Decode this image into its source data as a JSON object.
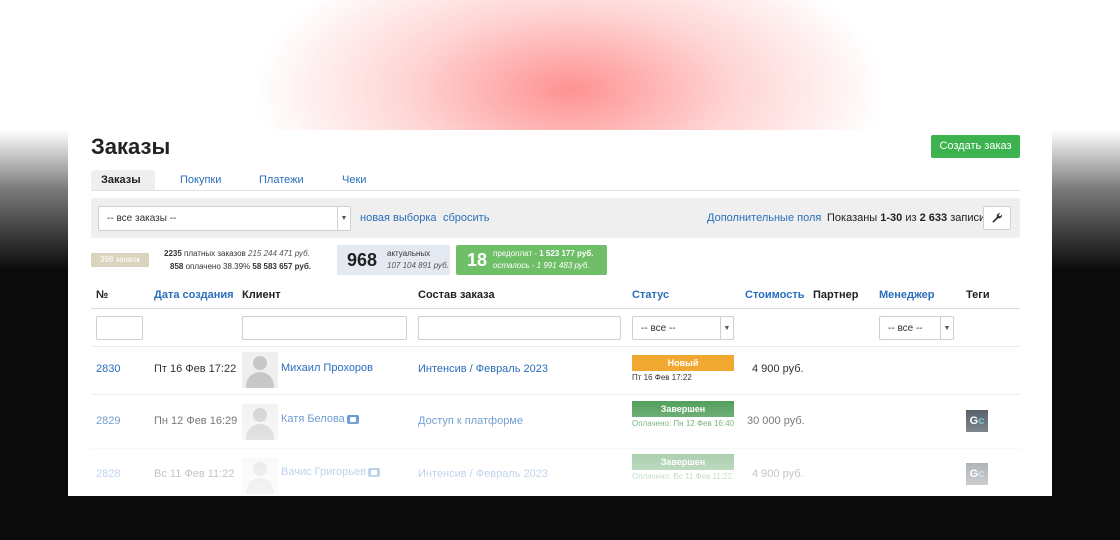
{
  "page": {
    "title": "Заказы",
    "create_button": "Создать заказ"
  },
  "tabs": [
    {
      "label": "Заказы",
      "active": true
    },
    {
      "label": "Покупки",
      "active": false
    },
    {
      "label": "Платежи",
      "active": false
    },
    {
      "label": "Чеки",
      "active": false
    }
  ],
  "filter": {
    "select_value": "-- все заказы --",
    "new_selection": "новая выборка",
    "reset": "сбросить",
    "extra_fields": "Дополнительные поля",
    "shown_prefix": "Показаны ",
    "shown_range": "1-30",
    "shown_mid": " из ",
    "shown_total": "2 633",
    "shown_suffix": " записи."
  },
  "stats": {
    "gray_badge": "398 заявок",
    "paid_count": "2235",
    "paid_label": " платных заказов ",
    "paid_sum": "215 244 471 руб.",
    "paid_done": "858",
    "paid_done_label": " оплачено 38.39% ",
    "paid_done_sum": "58 583 657 руб.",
    "actual_count": "968",
    "actual_label": "актуальных",
    "actual_sum": "107 104 891 руб.",
    "prepay_count": "18",
    "prepay_label": "предоплат - ",
    "prepay_sum": "1 523 177 руб.",
    "remain_label": "осталось - ",
    "remain_sum": "1 991 483 руб."
  },
  "columns": {
    "num": "№",
    "created": "Дата создания",
    "client": "Клиент",
    "content": "Состав заказа",
    "status": "Статус",
    "cost": "Стоимость",
    "partner": "Партнер",
    "manager": "Менеджер",
    "tags": "Теги"
  },
  "column_filters": {
    "status_all": "-- все --",
    "manager_all": "-- все --"
  },
  "rows": [
    {
      "id": "2830",
      "date": "Пт 16 Фев 17:22",
      "client": "Михаил Прохоров",
      "content": "Интенсив / Февраль 2023",
      "status": "Новый",
      "status_color": "#f0a830",
      "status_sub": "Пт 16 Фев 17:22",
      "cost": "4 900 руб."
    },
    {
      "id": "2829",
      "date": "Пн 12 Фев 16:29",
      "client": "Катя Белова",
      "content": "Доступ к платформе",
      "status": "Завершен",
      "status_color": "#2e8b3a",
      "status_sub": "Оплачено: Пн 12 Фев 16:40",
      "cost": "30 000 руб.",
      "tag": "GC"
    },
    {
      "id": "2828",
      "date": "Вс 11 Фев 11:22",
      "client": "Вачис Григорьев",
      "content": "Интенсив / Февраль 2023",
      "status": "Завершен",
      "status_color": "#2e8b3a",
      "status_sub": "Оплачено: Вс 11 Фев 11:22",
      "cost": "4 900 руб.",
      "tag": "GC"
    }
  ]
}
